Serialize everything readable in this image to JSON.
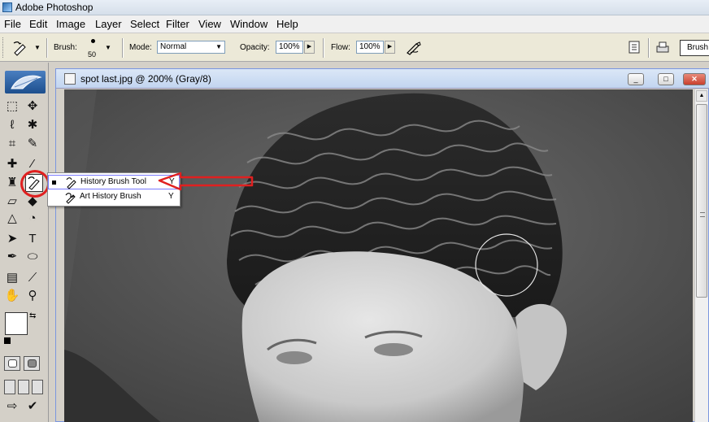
{
  "window": {
    "title": "Adobe Photoshop"
  },
  "menu": [
    "File",
    "Edit",
    "Image",
    "Layer",
    "Select",
    "Filter",
    "View",
    "Window",
    "Help"
  ],
  "options": {
    "brush_label": "Brush:",
    "brush_size": "50",
    "mode_label": "Mode:",
    "mode_value": "Normal",
    "opacity_label": "Opacity:",
    "opacity_value": "100%",
    "flow_label": "Flow:",
    "flow_value": "100%",
    "brushes_tab": "Brush"
  },
  "document": {
    "title": "spot last.jpg @ 200% (Gray/8)",
    "minimize": "_",
    "maximize": "□",
    "close": "✕"
  },
  "flyout": {
    "items": [
      {
        "label": "History Brush Tool",
        "key": "Y",
        "icon": "history-brush-icon"
      },
      {
        "label": "Art History Brush",
        "key": "Y",
        "icon": "art-history-brush-icon"
      }
    ]
  },
  "colors": {
    "annotation": "#e02020",
    "selection_outline": "#7a7aff"
  }
}
